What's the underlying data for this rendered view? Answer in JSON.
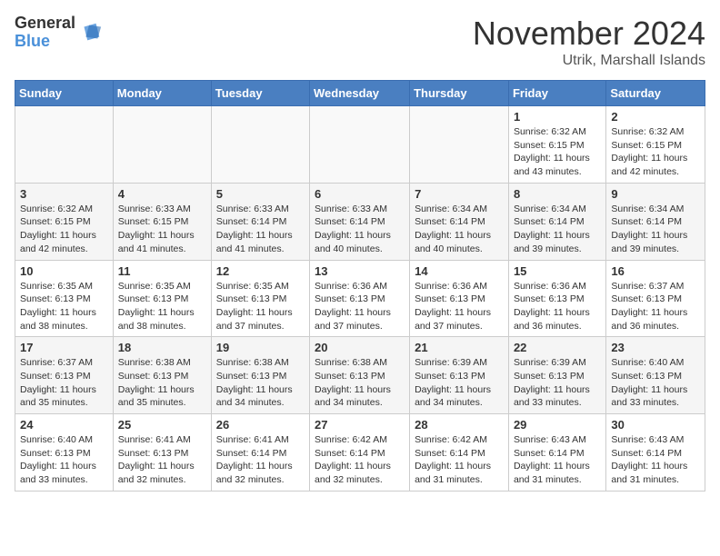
{
  "logo": {
    "general": "General",
    "blue": "Blue"
  },
  "title": "November 2024",
  "location": "Utrik, Marshall Islands",
  "days_of_week": [
    "Sunday",
    "Monday",
    "Tuesday",
    "Wednesday",
    "Thursday",
    "Friday",
    "Saturday"
  ],
  "weeks": [
    [
      {
        "day": "",
        "info": ""
      },
      {
        "day": "",
        "info": ""
      },
      {
        "day": "",
        "info": ""
      },
      {
        "day": "",
        "info": ""
      },
      {
        "day": "",
        "info": ""
      },
      {
        "day": "1",
        "info": "Sunrise: 6:32 AM\nSunset: 6:15 PM\nDaylight: 11 hours\nand 43 minutes."
      },
      {
        "day": "2",
        "info": "Sunrise: 6:32 AM\nSunset: 6:15 PM\nDaylight: 11 hours\nand 42 minutes."
      }
    ],
    [
      {
        "day": "3",
        "info": "Sunrise: 6:32 AM\nSunset: 6:15 PM\nDaylight: 11 hours\nand 42 minutes."
      },
      {
        "day": "4",
        "info": "Sunrise: 6:33 AM\nSunset: 6:15 PM\nDaylight: 11 hours\nand 41 minutes."
      },
      {
        "day": "5",
        "info": "Sunrise: 6:33 AM\nSunset: 6:14 PM\nDaylight: 11 hours\nand 41 minutes."
      },
      {
        "day": "6",
        "info": "Sunrise: 6:33 AM\nSunset: 6:14 PM\nDaylight: 11 hours\nand 40 minutes."
      },
      {
        "day": "7",
        "info": "Sunrise: 6:34 AM\nSunset: 6:14 PM\nDaylight: 11 hours\nand 40 minutes."
      },
      {
        "day": "8",
        "info": "Sunrise: 6:34 AM\nSunset: 6:14 PM\nDaylight: 11 hours\nand 39 minutes."
      },
      {
        "day": "9",
        "info": "Sunrise: 6:34 AM\nSunset: 6:14 PM\nDaylight: 11 hours\nand 39 minutes."
      }
    ],
    [
      {
        "day": "10",
        "info": "Sunrise: 6:35 AM\nSunset: 6:13 PM\nDaylight: 11 hours\nand 38 minutes."
      },
      {
        "day": "11",
        "info": "Sunrise: 6:35 AM\nSunset: 6:13 PM\nDaylight: 11 hours\nand 38 minutes."
      },
      {
        "day": "12",
        "info": "Sunrise: 6:35 AM\nSunset: 6:13 PM\nDaylight: 11 hours\nand 37 minutes."
      },
      {
        "day": "13",
        "info": "Sunrise: 6:36 AM\nSunset: 6:13 PM\nDaylight: 11 hours\nand 37 minutes."
      },
      {
        "day": "14",
        "info": "Sunrise: 6:36 AM\nSunset: 6:13 PM\nDaylight: 11 hours\nand 37 minutes."
      },
      {
        "day": "15",
        "info": "Sunrise: 6:36 AM\nSunset: 6:13 PM\nDaylight: 11 hours\nand 36 minutes."
      },
      {
        "day": "16",
        "info": "Sunrise: 6:37 AM\nSunset: 6:13 PM\nDaylight: 11 hours\nand 36 minutes."
      }
    ],
    [
      {
        "day": "17",
        "info": "Sunrise: 6:37 AM\nSunset: 6:13 PM\nDaylight: 11 hours\nand 35 minutes."
      },
      {
        "day": "18",
        "info": "Sunrise: 6:38 AM\nSunset: 6:13 PM\nDaylight: 11 hours\nand 35 minutes."
      },
      {
        "day": "19",
        "info": "Sunrise: 6:38 AM\nSunset: 6:13 PM\nDaylight: 11 hours\nand 34 minutes."
      },
      {
        "day": "20",
        "info": "Sunrise: 6:38 AM\nSunset: 6:13 PM\nDaylight: 11 hours\nand 34 minutes."
      },
      {
        "day": "21",
        "info": "Sunrise: 6:39 AM\nSunset: 6:13 PM\nDaylight: 11 hours\nand 34 minutes."
      },
      {
        "day": "22",
        "info": "Sunrise: 6:39 AM\nSunset: 6:13 PM\nDaylight: 11 hours\nand 33 minutes."
      },
      {
        "day": "23",
        "info": "Sunrise: 6:40 AM\nSunset: 6:13 PM\nDaylight: 11 hours\nand 33 minutes."
      }
    ],
    [
      {
        "day": "24",
        "info": "Sunrise: 6:40 AM\nSunset: 6:13 PM\nDaylight: 11 hours\nand 33 minutes."
      },
      {
        "day": "25",
        "info": "Sunrise: 6:41 AM\nSunset: 6:13 PM\nDaylight: 11 hours\nand 32 minutes."
      },
      {
        "day": "26",
        "info": "Sunrise: 6:41 AM\nSunset: 6:14 PM\nDaylight: 11 hours\nand 32 minutes."
      },
      {
        "day": "27",
        "info": "Sunrise: 6:42 AM\nSunset: 6:14 PM\nDaylight: 11 hours\nand 32 minutes."
      },
      {
        "day": "28",
        "info": "Sunrise: 6:42 AM\nSunset: 6:14 PM\nDaylight: 11 hours\nand 31 minutes."
      },
      {
        "day": "29",
        "info": "Sunrise: 6:43 AM\nSunset: 6:14 PM\nDaylight: 11 hours\nand 31 minutes."
      },
      {
        "day": "30",
        "info": "Sunrise: 6:43 AM\nSunset: 6:14 PM\nDaylight: 11 hours\nand 31 minutes."
      }
    ]
  ]
}
